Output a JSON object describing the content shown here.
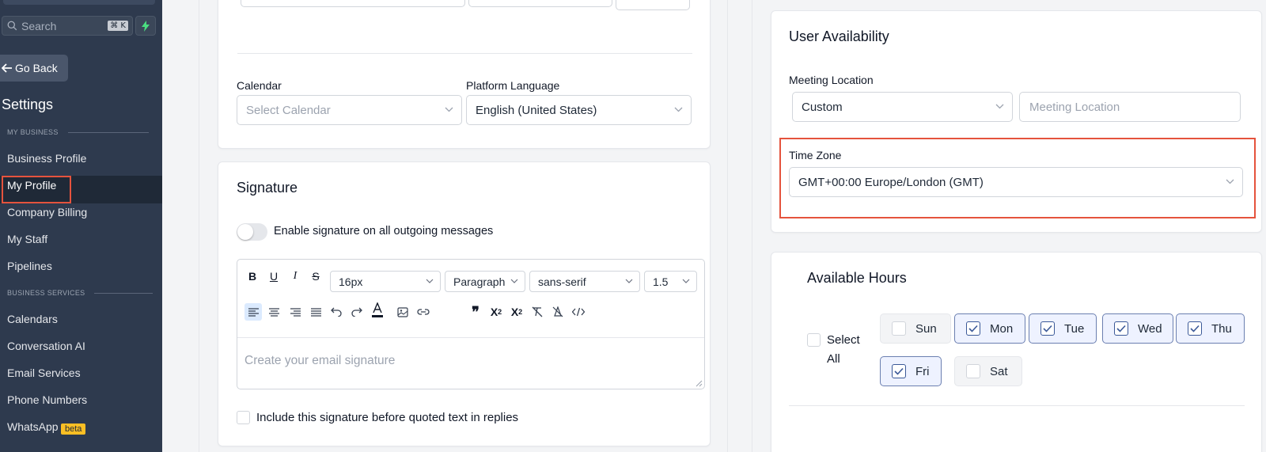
{
  "sidebar": {
    "search_placeholder": "Search",
    "search_shortcut": "⌘ K",
    "go_back": "Go Back",
    "title": "Settings",
    "section_my_business": "MY BUSINESS",
    "section_business_services": "BUSINESS SERVICES",
    "items": [
      {
        "label": "Business Profile"
      },
      {
        "label": "My Profile",
        "active": true
      },
      {
        "label": "Company Billing"
      },
      {
        "label": "My Staff"
      },
      {
        "label": "Pipelines"
      },
      {
        "label": "Calendars"
      },
      {
        "label": "Conversation AI"
      },
      {
        "label": "Email Services"
      },
      {
        "label": "Phone Numbers"
      },
      {
        "label": "WhatsApp"
      }
    ],
    "whatsapp_badge": "beta"
  },
  "profile": {
    "calendar_label": "Calendar",
    "calendar_placeholder": "Select Calendar",
    "language_label": "Platform Language",
    "language_value": "English (United States)"
  },
  "signature": {
    "title": "Signature",
    "toggle_label": "Enable signature on all outgoing messages",
    "font_size": "16px",
    "block_type": "Paragraph",
    "font_family": "sans-serif",
    "line_height": "1.5",
    "editor_placeholder": "Create your email signature",
    "include_label": "Include this signature before quoted text in replies"
  },
  "availability": {
    "title": "User Availability",
    "meeting_location_label": "Meeting Location",
    "meeting_location_type": "Custom",
    "meeting_location_placeholder": "Meeting Location",
    "timezone_label": "Time Zone",
    "timezone_value": "GMT+00:00 Europe/London (GMT)"
  },
  "hours": {
    "title": "Available Hours",
    "select_all_line1": "Select",
    "select_all_line2": "All",
    "days": [
      {
        "label": "Sun",
        "checked": false
      },
      {
        "label": "Mon",
        "checked": true
      },
      {
        "label": "Tue",
        "checked": true
      },
      {
        "label": "Wed",
        "checked": true
      },
      {
        "label": "Thu",
        "checked": true
      },
      {
        "label": "Fri",
        "checked": true
      },
      {
        "label": "Sat",
        "checked": false
      }
    ]
  },
  "colors": {
    "sidebar_bg": "#2e3a4e",
    "highlight": "#e5533d",
    "badge": "#fbbf24"
  }
}
